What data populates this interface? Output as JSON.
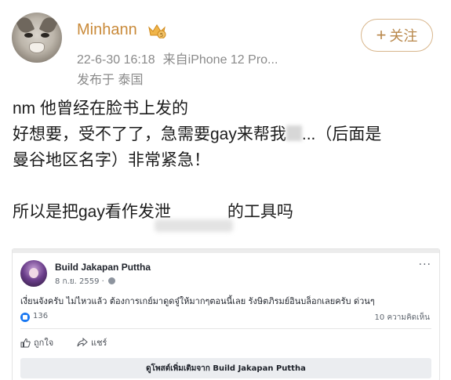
{
  "post": {
    "author": "Minhann",
    "timestamp": "22-6-30 16:18",
    "source": "来自iPhone 12 Pro...",
    "location": "发布于 泰国",
    "follow_label": "关注",
    "body": {
      "line1": "nm 他曾经在脸书上发的",
      "line2_before": "好想要，受不了了，急需要gay来帮我",
      "line2_after": "...（后面是",
      "line3": "曼谷地区名字）非常紧急！",
      "line4_before": "所以是把gay看作",
      "line4_partial": "发泄",
      "line4_after": "的工具吗"
    }
  },
  "embed": {
    "page_name": "Build Jakapan Puttha",
    "date": "8 ก.ย. 2559 ·",
    "text": "เงี่ยนจังครับ ไม่ไหวแล้ว ต้องการเกย์มาดูดจู๋ให้มากๆตอนนี้เลย รังษิตภิรมย์อินบล็อกเลยครับ ด่วนๆ",
    "like_count": "136",
    "comment_count": "10 ความคิดเห็น",
    "like_label": "ถูกใจ",
    "share_label": "แชร์",
    "more_button": "ดูโพสต์เพิ่มเติมจาก Build Jakapan Puttha"
  },
  "colors": {
    "username": "#c98a3a",
    "follow_border": "#d8b68c",
    "meta_gray": "#8a8a8a",
    "fb_blue": "#1877f2"
  }
}
